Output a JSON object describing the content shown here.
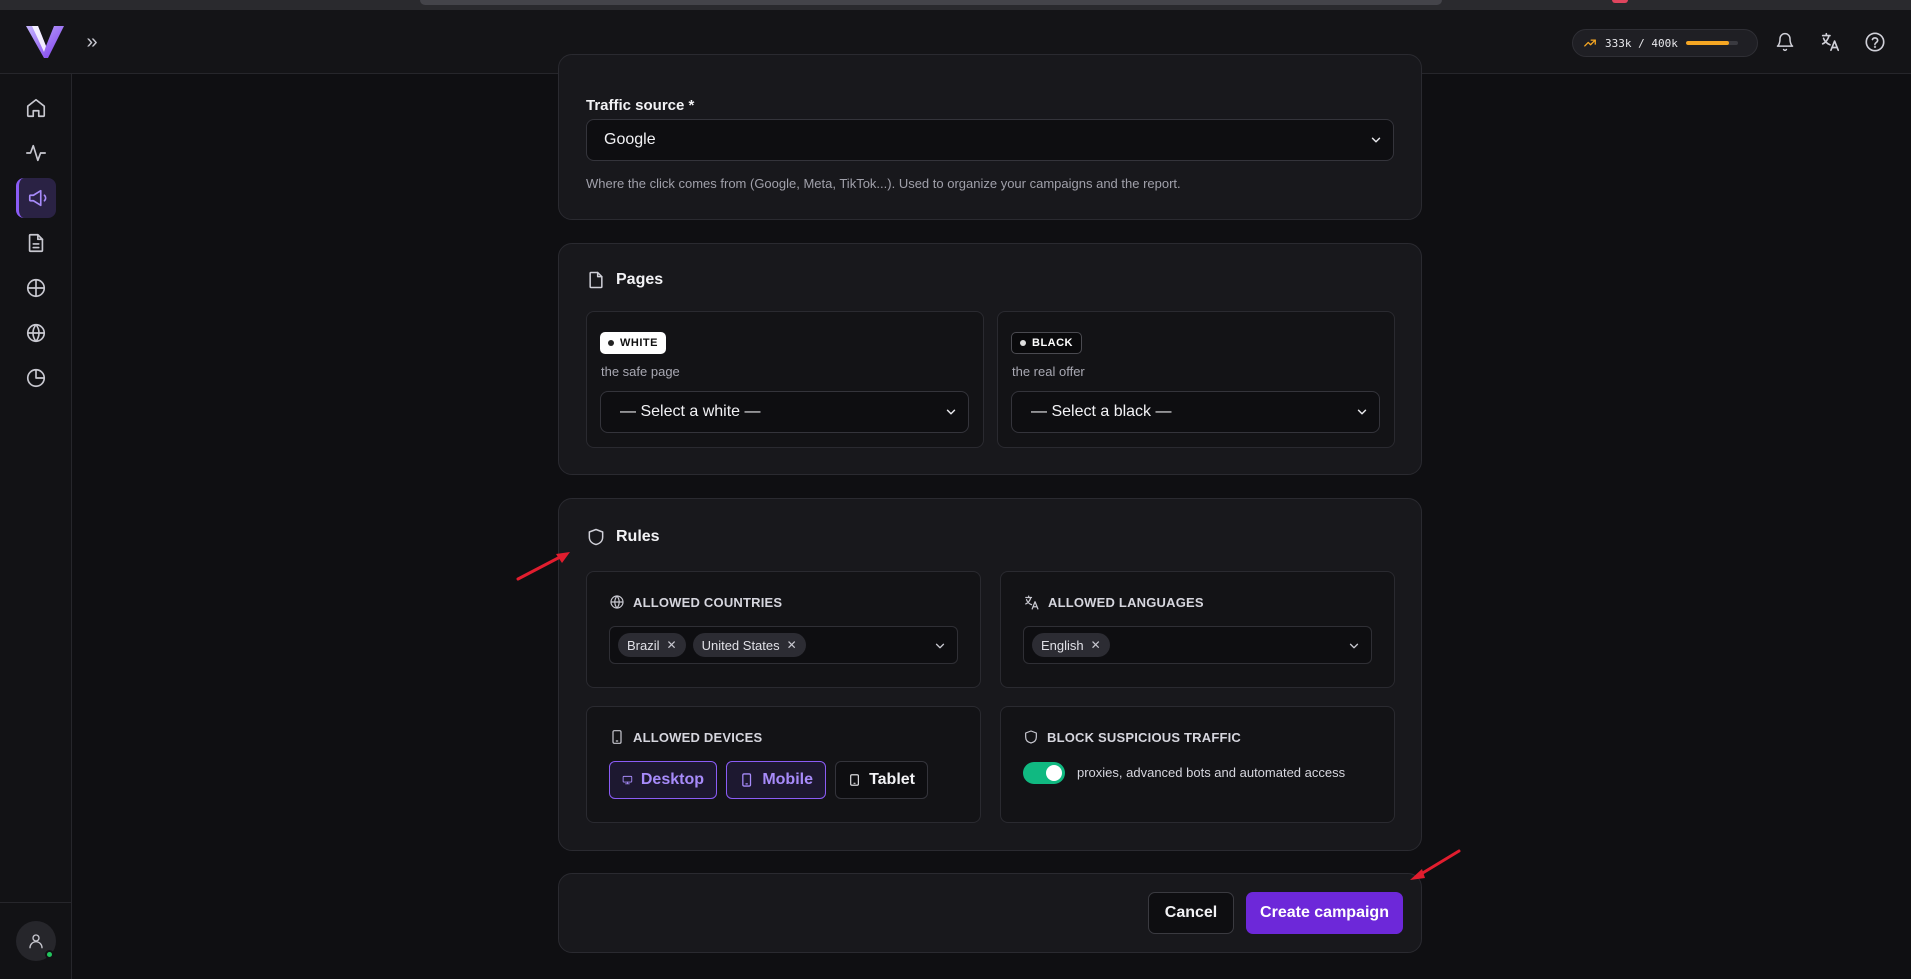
{
  "header": {
    "usage_text": "333k / 400k",
    "usage_fraction": 0.8325,
    "accent_color": "#8b5cf6",
    "usage_color": "#f5a623",
    "icons": [
      "expand-icon",
      "bell-icon",
      "translate-icon",
      "help-icon"
    ]
  },
  "sidebar": {
    "items": [
      {
        "icon": "home-icon"
      },
      {
        "icon": "activity-icon"
      },
      {
        "icon": "megaphone-icon",
        "active": true
      },
      {
        "icon": "document-icon"
      },
      {
        "icon": "crosshair-icon"
      },
      {
        "icon": "globe-icon"
      },
      {
        "icon": "pie-chart-icon"
      }
    ],
    "user_icon": "user-icon"
  },
  "traffic": {
    "label": "Traffic source *",
    "value": "Google",
    "hint": "Where the click comes from (Google, Meta, TikTok...). Used to organize your campaigns and the report."
  },
  "pages": {
    "title": "Pages",
    "white": {
      "badge": "WHITE",
      "hint": "the safe page",
      "placeholder": "— Select a white —"
    },
    "black": {
      "badge": "BLACK",
      "hint": "the real offer",
      "placeholder": "— Select a black —"
    }
  },
  "rules": {
    "title": "Rules",
    "countries": {
      "label": "ALLOWED COUNTRIES",
      "chips": [
        "Brazil",
        "United States"
      ]
    },
    "languages": {
      "label": "ALLOWED LANGUAGES",
      "chips": [
        "English"
      ]
    },
    "devices": {
      "label": "ALLOWED DEVICES",
      "options": [
        {
          "label": "Desktop",
          "selected": true
        },
        {
          "label": "Mobile",
          "selected": true
        },
        {
          "label": "Tablet",
          "selected": false
        }
      ]
    },
    "suspicious": {
      "label": "BLOCK SUSPICIOUS TRAFFIC",
      "enabled": true,
      "description": "proxies, advanced bots and automated access"
    }
  },
  "actions": {
    "cancel": "Cancel",
    "create": "Create campaign"
  },
  "annotation_color": "#e11d2e"
}
